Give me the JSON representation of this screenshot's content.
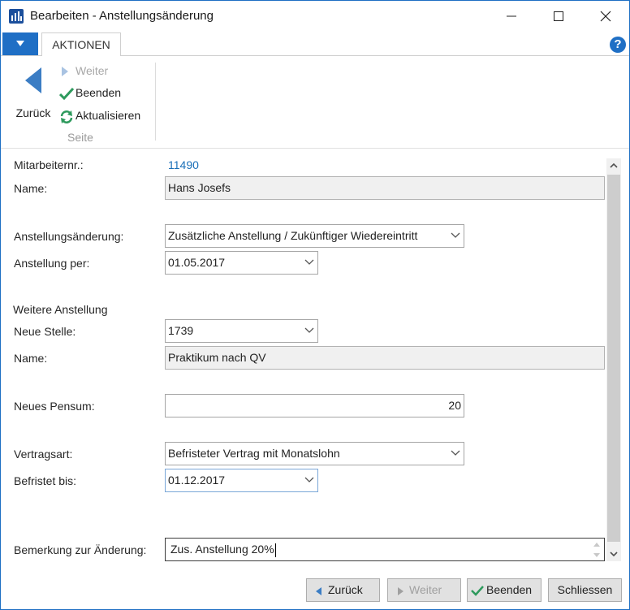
{
  "window": {
    "title": "Bearbeiten - Anstellungsänderung",
    "controls": [
      "minimize-icon",
      "maximize-icon",
      "close-icon"
    ]
  },
  "ribbon": {
    "tab": "AKTIONEN",
    "actions": {
      "back": "Zurück",
      "next": "Weiter",
      "finish": "Beenden",
      "refresh": "Aktualisieren"
    },
    "group_label": "Seite"
  },
  "form": {
    "employee_no_label": "Mitarbeiternr.:",
    "employee_no": "11490",
    "name_label": "Name:",
    "name": "Hans Josefs",
    "change_label": "Anstellungsänderung:",
    "change_value": "Zusätzliche Anstellung / Zukünftiger Wiedereintritt",
    "date_label": "Anstellung per:",
    "date_value": "01.05.2017",
    "section_title": "Weitere Anstellung",
    "position_label": "Neue Stelle:",
    "position_value": "1739",
    "position_name_label": "Name:",
    "position_name": "Praktikum nach QV",
    "pensum_label": "Neues Pensum:",
    "pensum_value": "20",
    "contract_label": "Vertragsart:",
    "contract_value": "Befristeter Vertrag mit Monatslohn",
    "limited_label": "Befristet bis:",
    "limited_value": "01.12.2017",
    "remark_label": "Bemerkung zur Änderung:",
    "remark_value": "Zus. Anstellung 20%"
  },
  "footer": {
    "back": "Zurück",
    "next": "Weiter",
    "finish": "Beenden",
    "close": "Schliessen"
  },
  "colors": {
    "accent": "#1f6fc5",
    "link": "#1a6fb8",
    "finish_check": "#2e9a5d",
    "disabled": "#a7a7a7"
  }
}
